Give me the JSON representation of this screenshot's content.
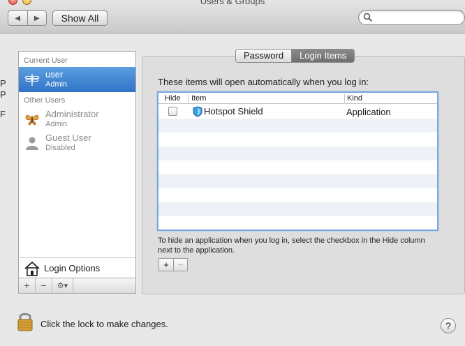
{
  "window": {
    "title": "Users & Groups",
    "back_glyph": "◀",
    "forward_glyph": "▶",
    "show_all": "Show All",
    "search_placeholder": ""
  },
  "edge_glyphs": [
    "P",
    "P",
    "F"
  ],
  "sidebar": {
    "current_user_header": "Current User",
    "current_user": {
      "name": "user",
      "role": "Admin"
    },
    "other_users_header": "Other Users",
    "other_users": [
      {
        "name": "Administrator",
        "role": "Admin"
      },
      {
        "name": "Guest User",
        "role": "Disabled"
      }
    ],
    "login_options": "Login Options",
    "add_glyph": "+",
    "remove_glyph": "−",
    "gear_glyph": "⚙▾"
  },
  "tabs": [
    {
      "label": "Password",
      "active": false
    },
    {
      "label": "Login Items",
      "active": true
    }
  ],
  "panel": {
    "heading": "These items will open automatically when you log in:",
    "columns": {
      "hide": "Hide",
      "item": "Item",
      "kind": "Kind"
    },
    "items": [
      {
        "hide": false,
        "name": "Hotspot Shield",
        "kind": "Application"
      }
    ],
    "hint": "To hide an application when you log in, select the checkbox in the Hide column next to the application.",
    "add_glyph": "+",
    "remove_glyph": "−"
  },
  "footer": {
    "lock_text": "Click the lock to make changes.",
    "help_glyph": "?"
  },
  "colors": {
    "selection": "#3d82d4",
    "focus_ring": "#7aa6dc",
    "active_tab": "#7c7c7c"
  }
}
